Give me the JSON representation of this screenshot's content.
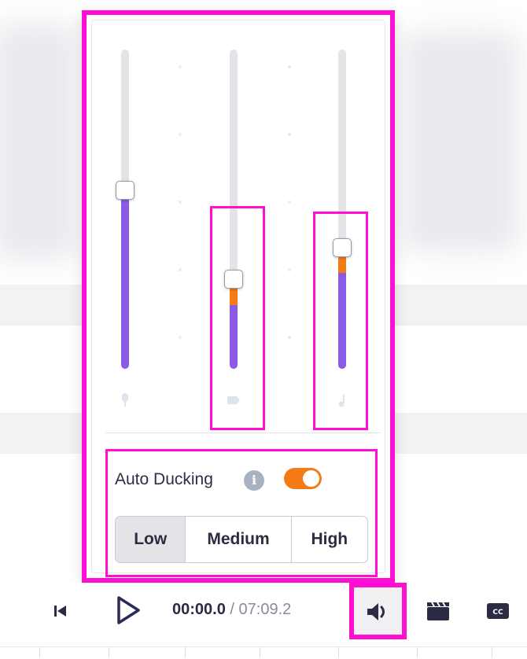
{
  "sliders": [
    {
      "id": "voice",
      "icon": "microphone-icon",
      "level": 0.56,
      "orange_part": 0,
      "highlighted": false
    },
    {
      "id": "video",
      "icon": "video-clip-icon",
      "level": 0.28,
      "orange_part": 0.08,
      "highlighted": true
    },
    {
      "id": "music",
      "icon": "music-note-icon",
      "level": 0.38,
      "orange_part": 0.08,
      "highlighted": true
    }
  ],
  "auto_ducking": {
    "label": "Auto Ducking",
    "info_icon": "info-icon",
    "enabled": true,
    "levels": [
      {
        "label": "Low",
        "selected": true
      },
      {
        "label": "Medium",
        "selected": false
      },
      {
        "label": "High",
        "selected": false
      }
    ]
  },
  "player": {
    "current_time": "00:00.0",
    "separator": "/",
    "total_time": "07:09.2",
    "icons": [
      "skip-back-icon",
      "play-icon",
      "volume-icon",
      "clapperboard-icon",
      "captions-icon"
    ]
  },
  "colors": {
    "accent_purple": "#8b5be6",
    "accent_orange": "#f47b16",
    "highlight_magenta": "#ff0fd2"
  }
}
